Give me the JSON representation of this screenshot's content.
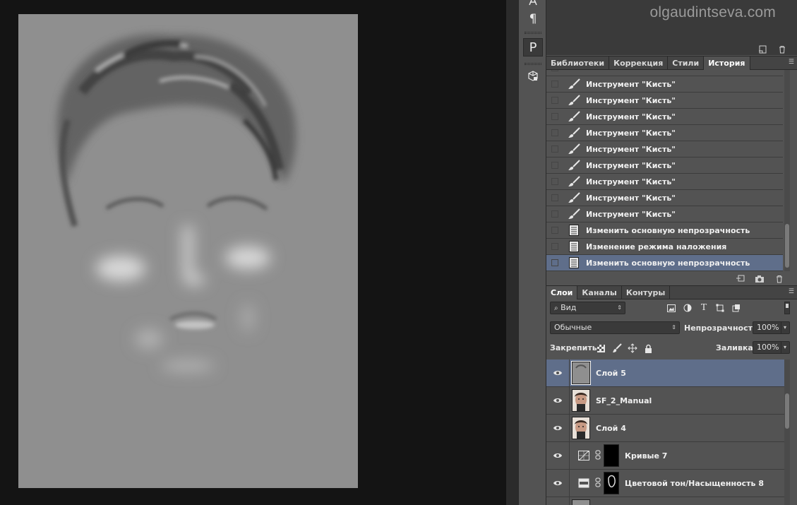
{
  "watermark": "olgaudintseva.com",
  "tools": {
    "paragraph": "¶",
    "type_path": "P",
    "icons": [
      "character-icon",
      "paragraph-icon",
      "type-path-icon",
      "3d-object-icon"
    ]
  },
  "history_panel": {
    "tabs": [
      {
        "label": "Библиотеки",
        "active": false
      },
      {
        "label": "Коррекция",
        "active": false
      },
      {
        "label": "Стили",
        "active": false
      },
      {
        "label": "История",
        "active": true
      }
    ],
    "items": [
      {
        "label": "Инструмент \"Кисть\"",
        "icon": "brush-icon",
        "selected": false
      },
      {
        "label": "Инструмент \"Кисть\"",
        "icon": "brush-icon",
        "selected": false
      },
      {
        "label": "Инструмент \"Кисть\"",
        "icon": "brush-icon",
        "selected": false
      },
      {
        "label": "Инструмент \"Кисть\"",
        "icon": "brush-icon",
        "selected": false
      },
      {
        "label": "Инструмент \"Кисть\"",
        "icon": "brush-icon",
        "selected": false
      },
      {
        "label": "Инструмент \"Кисть\"",
        "icon": "brush-icon",
        "selected": false
      },
      {
        "label": "Инструмент \"Кисть\"",
        "icon": "brush-icon",
        "selected": false
      },
      {
        "label": "Инструмент \"Кисть\"",
        "icon": "brush-icon",
        "selected": false
      },
      {
        "label": "Инструмент \"Кисть\"",
        "icon": "brush-icon",
        "selected": false
      },
      {
        "label": "Изменить основную непрозрачность",
        "icon": "document-icon",
        "selected": false
      },
      {
        "label": "Изменение режима наложения",
        "icon": "document-icon",
        "selected": false
      },
      {
        "label": "Изменить основную непрозрачность",
        "icon": "document-icon",
        "selected": true
      }
    ]
  },
  "layers_panel": {
    "tabs": [
      {
        "label": "Слои",
        "active": true
      },
      {
        "label": "Каналы",
        "active": false
      },
      {
        "label": "Контуры",
        "active": false
      }
    ],
    "filter_label": "Вид",
    "blend_mode": "Обычные",
    "opacity_label": "Непрозрачность:",
    "opacity_value": "100%",
    "lock_label": "Закрепить:",
    "fill_label": "Заливка:",
    "fill_value": "100%",
    "layers": [
      {
        "name": "Слой 5",
        "kind": "pixel-gray",
        "selected": true
      },
      {
        "name": "SF_2_Manual",
        "kind": "pixel-photo",
        "selected": false
      },
      {
        "name": "Слой 4",
        "kind": "pixel-photo",
        "selected": false
      },
      {
        "name": "Кривые 7",
        "kind": "curves",
        "selected": false
      },
      {
        "name": "Цветовой тон/Насыщенность 8",
        "kind": "hue-sat",
        "selected": false
      }
    ]
  },
  "colors": {
    "selection": "#5f6e8a",
    "panel": "#535353",
    "canvas_gray": "#8f8f8f"
  }
}
